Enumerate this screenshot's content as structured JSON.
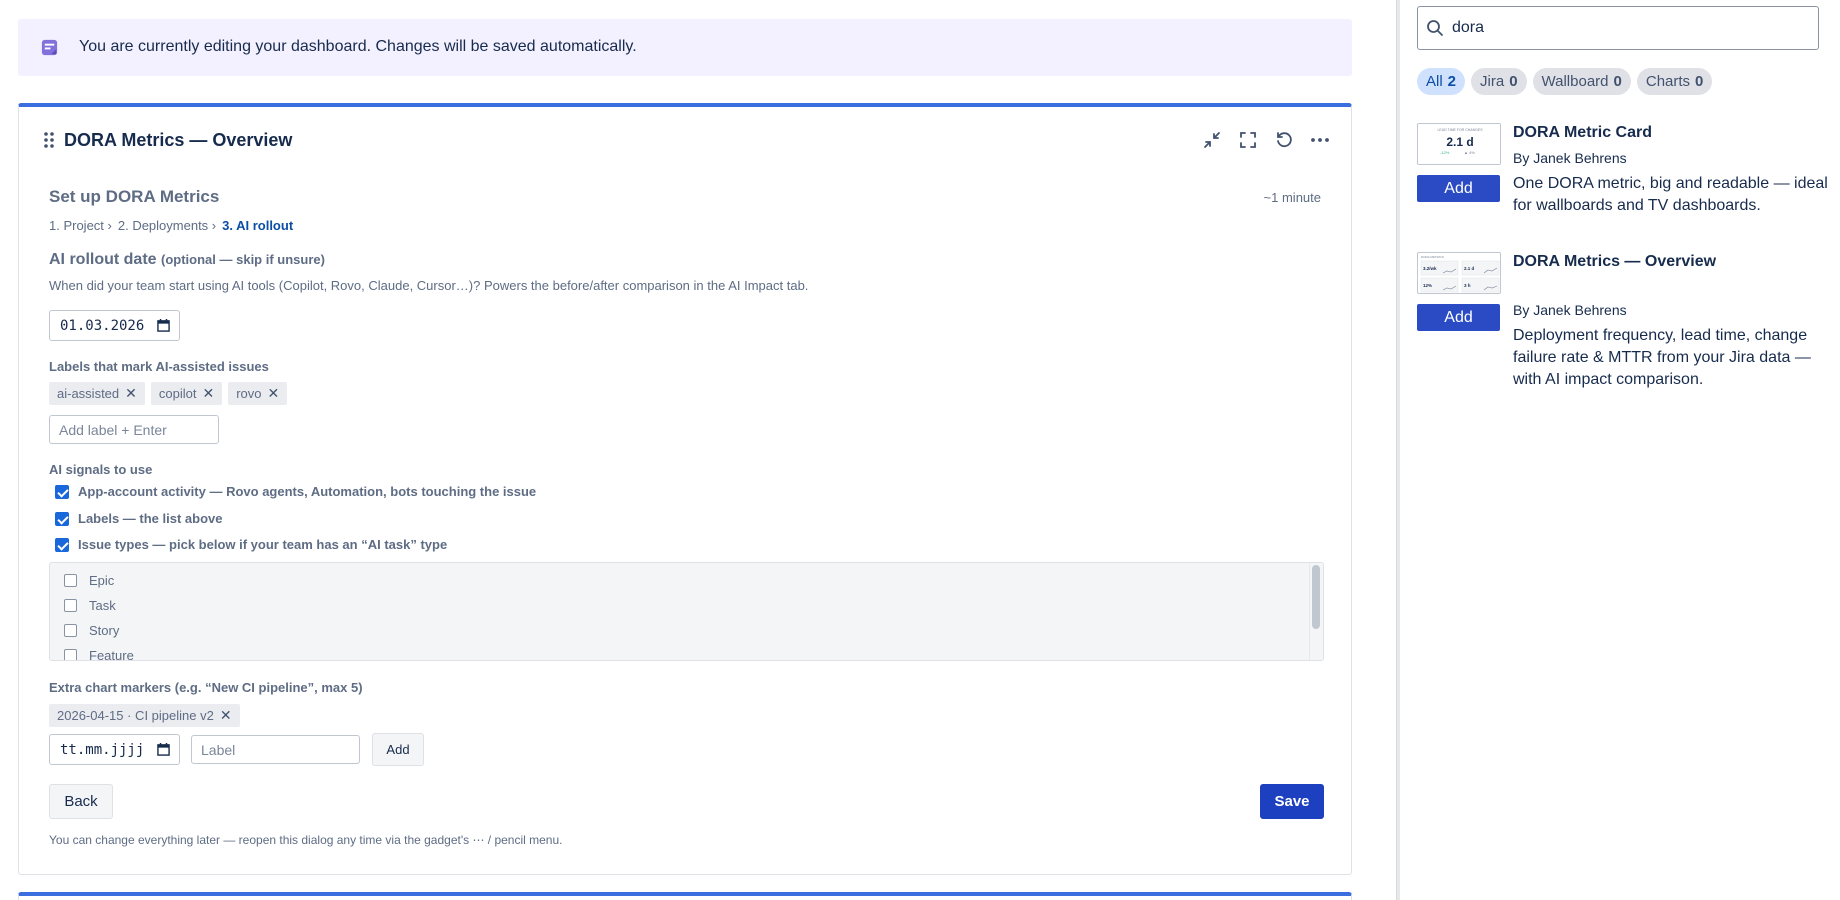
{
  "banner": {
    "text": "You are currently editing your dashboard. Changes will be saved automatically."
  },
  "gadget": {
    "title": "DORA Metrics — Overview",
    "actions": [
      "collapse-icon",
      "fullscreen-icon",
      "refresh-icon",
      "more-icon"
    ]
  },
  "setup": {
    "title": "Set up DORA Metrics",
    "duration": "~1 minute",
    "steps": [
      "1. Project ›",
      "2. Deployments ›",
      "3. AI rollout"
    ]
  },
  "rollout": {
    "label": "AI rollout date",
    "label_optional": "(optional — skip if unsure)",
    "help": "When did your team start using AI tools (Copilot, Rovo, Claude, Cursor…)? Powers the before/after comparison in the AI Impact tab.",
    "date_value": "01.03.2026"
  },
  "labels_section": {
    "label": "Labels that mark AI-assisted issues",
    "chips": [
      "ai-assisted",
      "copilot",
      "rovo"
    ],
    "chip_remove": "✕",
    "input_placeholder": "Add label + Enter"
  },
  "signals": {
    "label": "AI signals to use",
    "options": [
      {
        "label": "App-account activity — Rovo agents, Automation, bots touching the issue",
        "checked": true
      },
      {
        "label": "Labels — the list above",
        "checked": true
      },
      {
        "label": "Issue types — pick below if your team has an “AI task” type",
        "checked": true
      }
    ]
  },
  "issue_types": [
    "Epic",
    "Task",
    "Story",
    "Feature"
  ],
  "markers": {
    "label": "Extra chart markers (e.g. “New CI pipeline”, max 5)",
    "chips": [
      "2026-04-15 · CI pipeline v2"
    ],
    "date_placeholder": "tt.mm.jjjj",
    "label_placeholder": "Label",
    "add_label": "Add"
  },
  "nav": {
    "back_label": "Back",
    "save_label": "Save"
  },
  "footer": {
    "note": "You can change everything later — reopen this dialog any time via the gadget's ⋯ / pencil menu."
  },
  "sidebar": {
    "search_value": "dora",
    "filters": [
      {
        "label": "All",
        "count": "2",
        "active": true
      },
      {
        "label": "Jira",
        "count": "0",
        "active": false
      },
      {
        "label": "Wallboard",
        "count": "0",
        "active": false
      },
      {
        "label": "Charts",
        "count": "0",
        "active": false
      }
    ],
    "results": [
      {
        "title": "DORA Metric Card",
        "author": "By Janek Behrens",
        "desc": "One DORA metric, big and readable — ideal for wallboards and TV dashboards.",
        "add_label": "Add",
        "thumb": {
          "headline": "LEAD TIME FOR CHANGES",
          "value": "2.1 d",
          "sub_left": "-12%",
          "sub_right": "▲ 4%"
        }
      },
      {
        "title": "DORA Metrics — Overview",
        "author": "By Janek Behrens",
        "desc": "Deployment frequency, lead time, change failure rate & MTTR from your Jira data — with AI impact comparison.",
        "add_label": "Add",
        "thumb": {
          "headline": "DORA METRICS",
          "v1": "3.2/wk",
          "v2": "2.1 d",
          "v3": "12%",
          "v4": "3 h"
        }
      }
    ]
  },
  "colors": {
    "accent": "#1d40c0",
    "banner_bg": "#f3f0ff",
    "top_border": "#3b6fe0",
    "active_filter_bg": "#cfe1fd"
  }
}
